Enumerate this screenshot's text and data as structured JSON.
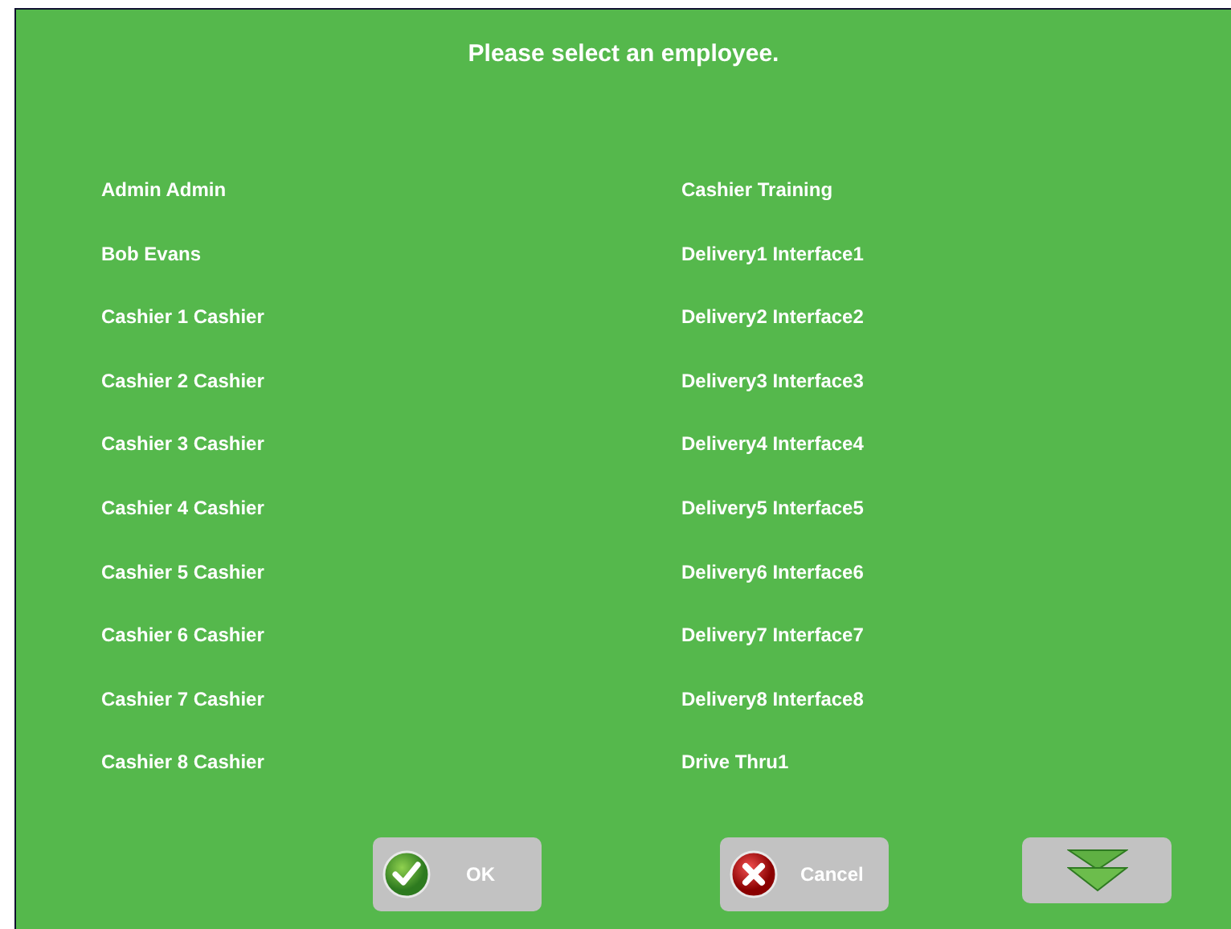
{
  "title": "Please select an employee.",
  "employees": [
    "Admin Admin",
    "Bob Evans",
    "Cashier 1 Cashier",
    "Cashier 2 Cashier",
    "Cashier 3 Cashier",
    "Cashier 4 Cashier",
    "Cashier 5 Cashier",
    "Cashier 6 Cashier",
    "Cashier 7 Cashier",
    "Cashier 8 Cashier",
    "Cashier Training",
    "Delivery1 Interface1",
    "Delivery2 Interface2",
    "Delivery3 Interface3",
    "Delivery4 Interface4",
    "Delivery5 Interface5",
    "Delivery6 Interface6",
    "Delivery7 Interface7",
    "Delivery8 Interface8",
    "Drive Thru1"
  ],
  "buttons": [
    {
      "kind": "ok",
      "label": "OK"
    },
    {
      "kind": "cancel",
      "label": "Cancel"
    },
    {
      "kind": "scroll-down"
    }
  ]
}
